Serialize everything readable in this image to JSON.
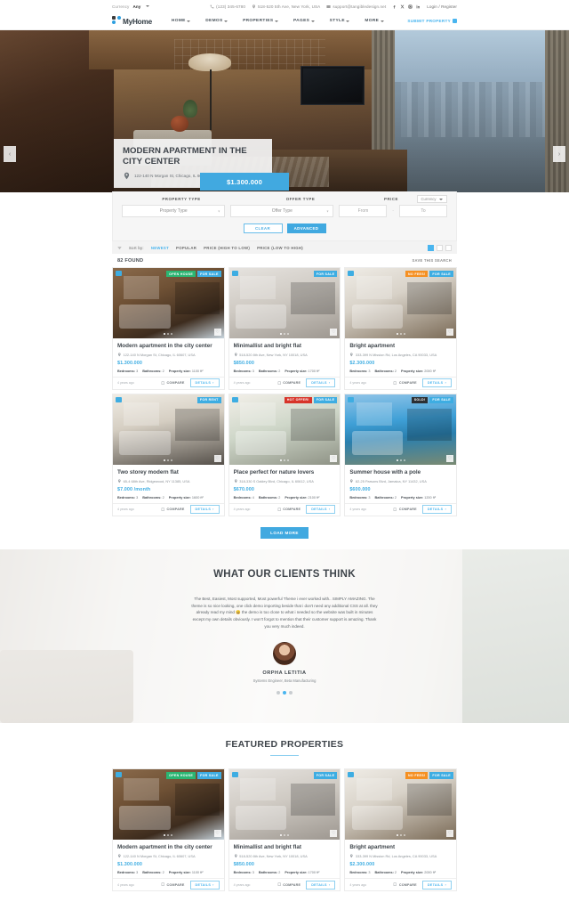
{
  "topbar": {
    "currency_label": "Currency",
    "currency_value": "Any",
    "phone": "(123) 345-6780",
    "address": "518-520 5th Ave, New York, USA",
    "email": "support@tangibledesign.net",
    "login": "Login / Register",
    "socials": [
      "facebook-icon",
      "x-twitter-icon",
      "instagram-icon",
      "linkedin-icon"
    ]
  },
  "header": {
    "logo_text": "MyHome",
    "nav": [
      {
        "label": "HOME"
      },
      {
        "label": "DEMOS"
      },
      {
        "label": "PROPERTIES"
      },
      {
        "label": "PAGES"
      },
      {
        "label": "STYLE"
      },
      {
        "label": "MORE"
      }
    ],
    "submit_property": "SUBMIT PROPERTY"
  },
  "hero": {
    "title": "MODERN APARTMENT IN THE CITY CENTER",
    "address": "122-140 N Morgan St, Chicago, IL 60607, USA",
    "price": "$1.300.000",
    "prev": "‹",
    "next": "›"
  },
  "search": {
    "label_property_type": "PROPERTY TYPE",
    "label_offer_type": "OFFER TYPE",
    "label_price": "PRICE",
    "currency_select": "Currency",
    "property_type_value": "Property Type",
    "offer_type_value": "Offer Type",
    "price_from_placeholder": "From",
    "price_to_placeholder": "To",
    "separator": "-",
    "clear_button": "CLEAR",
    "advanced_button": "ADVANCED"
  },
  "sort": {
    "sort_by_label": "Sort by:",
    "options": [
      {
        "label": "NEWEST",
        "active": true
      },
      {
        "label": "POPULAR",
        "active": false
      },
      {
        "label": "PRICE (HIGH TO LOW)",
        "active": false
      },
      {
        "label": "PRICE (LOW TO HIGH)",
        "active": false
      }
    ],
    "found_count": "82 FOUND",
    "save_this_search": "SAVE THIS SEARCH"
  },
  "card_common": {
    "bedrooms_label": "Bedrooms:",
    "bathrooms_label": "Bathrooms:",
    "size_label": "Property size:",
    "compare": "COMPARE",
    "details": "DETAILS",
    "details_arrow": "›",
    "favorite_icon": "♡"
  },
  "listings": [
    {
      "title": "Modern apartment in the city center",
      "address": "122-140 N Morgan St, Chicago, IL 60607, USA",
      "price": "$1.300.000",
      "bedrooms": "3",
      "bathrooms": "2",
      "size": "1100 ft²",
      "age": "4 years ago",
      "badges": [
        {
          "text": "OPEN HOUSE",
          "kind": "b-open"
        },
        {
          "text": "FOR SALE",
          "kind": "b-sale"
        }
      ],
      "photo": "ph-a"
    },
    {
      "title": "Minimallist and bright flat",
      "address": "518-520 8th Ave, New York, NY 10018, USA",
      "price": "$850.000",
      "bedrooms": "3",
      "bathrooms": "2",
      "size": "1700 ft²",
      "age": "4 years ago",
      "badges": [
        {
          "text": "FOR SALE",
          "kind": "b-sale"
        }
      ],
      "photo": "ph-b"
    },
    {
      "title": "Bright apartment",
      "address": "333-399 N Mission Rd, Los Angeles, CA 90033, USA",
      "price": "$2.300.000",
      "bedrooms": "3",
      "bathrooms": "2",
      "size": "2000 ft²",
      "age": "4 years ago",
      "badges": [
        {
          "text": "NO FEES!",
          "kind": "b-nofees"
        },
        {
          "text": "FOR SALE",
          "kind": "b-sale"
        }
      ],
      "photo": "ph-c"
    },
    {
      "title": "Two storey modern flat",
      "address": "65-4 68th Ave, Ridgewood, NY 11385, USA",
      "price": "$7.000 /month",
      "bedrooms": "3",
      "bathrooms": "2",
      "size": "1600 ft²",
      "age": "4 years ago",
      "badges": [
        {
          "text": "FOR RENT",
          "kind": "b-rent"
        }
      ],
      "photo": "ph-d"
    },
    {
      "title": "Place perfect for nature lovers",
      "address": "318-330 S Oakley Blvd, Chicago, IL 60612, USA",
      "price": "$670.000",
      "bedrooms": "4",
      "bathrooms": "2",
      "size": "2100 ft²",
      "age": "4 years ago",
      "badges": [
        {
          "text": "HOT OFFER!",
          "kind": "b-hot"
        },
        {
          "text": "FOR SALE",
          "kind": "b-sale"
        }
      ],
      "photo": "ph-e"
    },
    {
      "title": "Summer house with a pole",
      "address": "82-25 Parsons Blvd, Jamaica, NY 11432, USA",
      "price": "$600.000",
      "bedrooms": "3",
      "bathrooms": "2",
      "size": "1200 ft²",
      "age": "4 years ago",
      "badges": [
        {
          "text": "SOLD!",
          "kind": "b-sold"
        },
        {
          "text": "FOR SALE",
          "kind": "b-sale"
        }
      ],
      "photo": "ph-f"
    }
  ],
  "load_more": "LOAD MORE",
  "testimonials": {
    "heading": "WHAT OUR CLIENTS THINK",
    "text": "The Best, Easiest, Most supported, Most powerful Theme i ever worked with.. SIMPLY AMAZING. The theme is so nice looking, one click demo importing beside that i don't need any additional CSS at all. they already read my mind 😀 the demo is too close to what i needed so the website was built in minutes except my own details obviously. I won't forgot to mention that their customer support is amazing. Thank you very much indeed.",
    "author": "ORPHA LETITIA",
    "role": "Systems Engineer, Beta Manufacturing",
    "dots": [
      false,
      true,
      false
    ]
  },
  "featured": {
    "heading": "FEATURED PROPERTIES",
    "items": [
      0,
      1,
      2
    ]
  },
  "colors": {
    "accent": "#41a9e0",
    "accent_light": "#49b5ef",
    "green": "#2bb673",
    "orange": "#f59022",
    "red": "#d7342a",
    "dark": "#2b2f33"
  }
}
